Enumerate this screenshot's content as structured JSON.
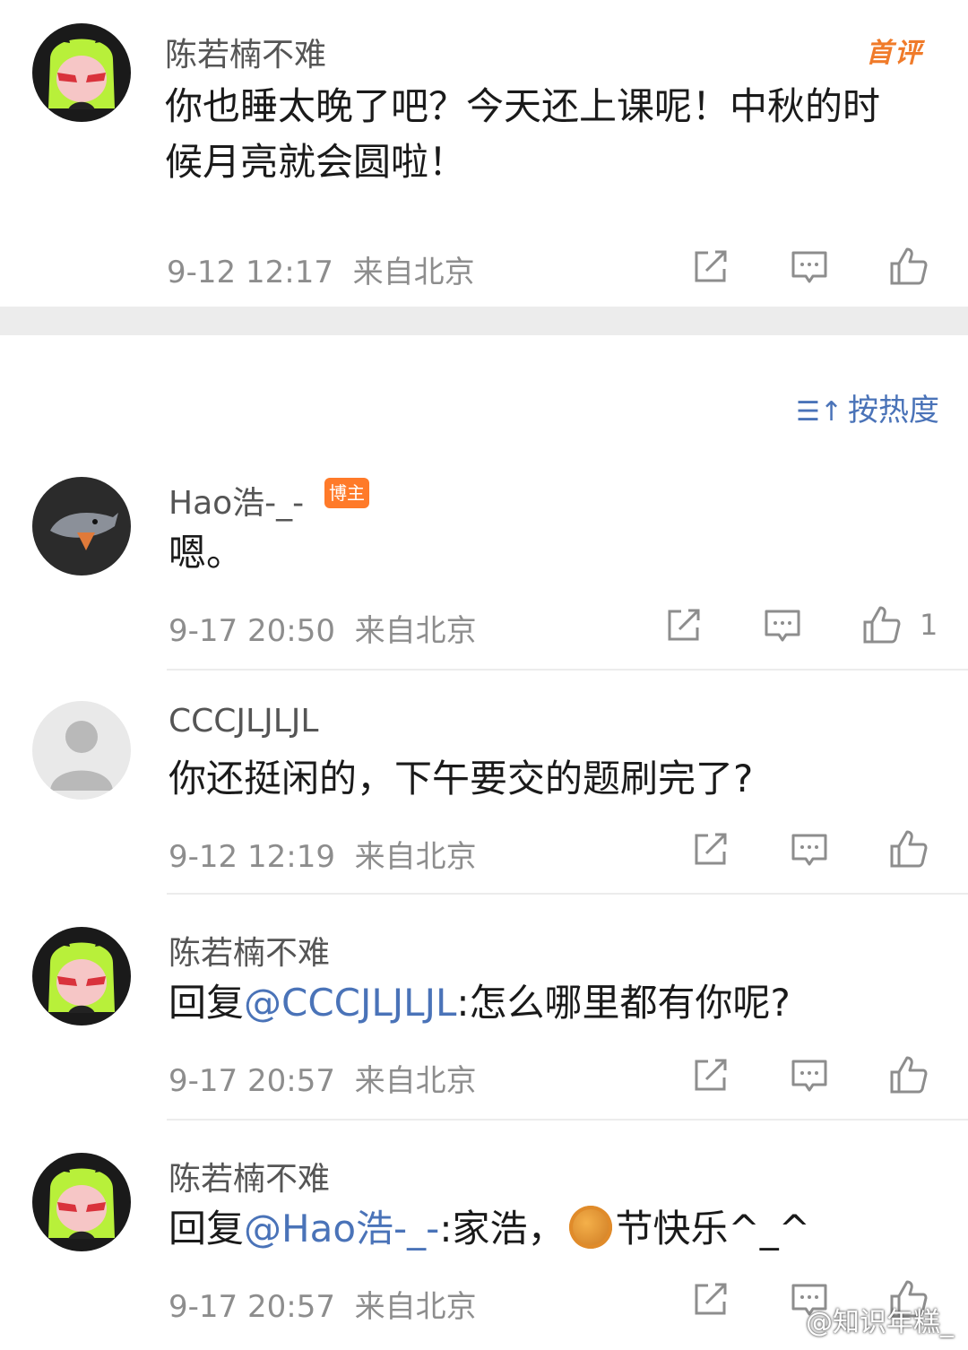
{
  "top_comment": {
    "user": "陈若楠不难",
    "badge": "首评",
    "text_line1": "你也睡太晚了吧？今天还上课呢！中秋的时",
    "text_line2": "候月亮就会圆啦！",
    "time": "9-12 12:17",
    "location": "来自北京"
  },
  "sort": {
    "label": "按热度",
    "icon": "sort-icon"
  },
  "replies": [
    {
      "user": "Hao浩-_-",
      "badge": "博主",
      "text": "嗯。",
      "time": "9-17 20:50",
      "location": "来自北京",
      "likes": "1"
    },
    {
      "user": "CCCJLJLJL",
      "text": "你还挺闲的，下午要交的题刷完了?",
      "time": "9-12 12:19",
      "location": "来自北京"
    },
    {
      "user": "陈若楠不难",
      "reply_prefix": "回复",
      "mention": "@CCCJLJLJL",
      "text": ":怎么哪里都有你呢?",
      "time": "9-17 20:57",
      "location": "来自北京"
    },
    {
      "user": "陈若楠不难",
      "reply_prefix": "回复",
      "mention": "@Hao浩-_-",
      "text_before": ":家浩，",
      "emoji": "mooncake-icon",
      "text_after": "节快乐^_^",
      "time": "9-17 20:57",
      "location": "来自北京"
    }
  ],
  "watermark": "@知识年糕_",
  "colors": {
    "accent": "#4a73b8",
    "badge_orange": "#ff7a29",
    "first_badge": "#f07b2a"
  }
}
